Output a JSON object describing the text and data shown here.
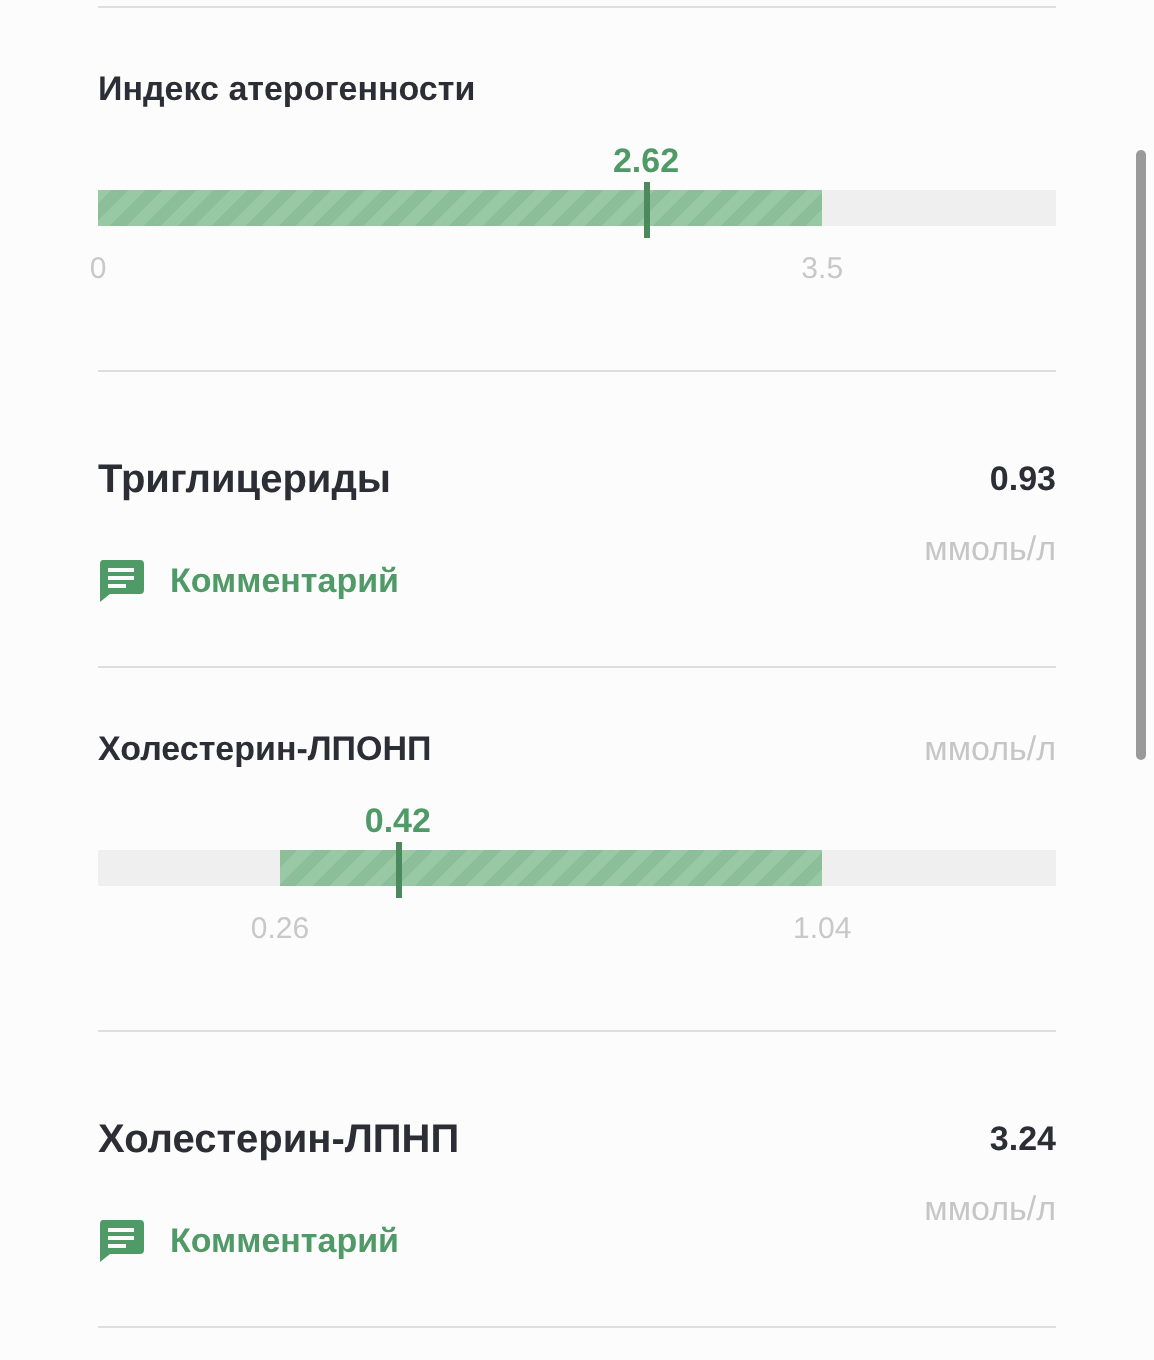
{
  "items": [
    {
      "kind": "range",
      "title": "Индекс атерогенности",
      "value": "2.62",
      "level": 0.572,
      "norm_from": {
        "label": "0"
      },
      "norm_to": {
        "level": 0.756,
        "label": "3.5"
      }
    },
    {
      "kind": "result",
      "title": "Триглицериды",
      "value": "0.93",
      "unit": "ммоль/л",
      "comment": "Комментарий"
    },
    {
      "kind": "range",
      "title": "Холестерин-ЛПОНП",
      "unit": "ммоль/л",
      "value": "0.42",
      "level": 0.313,
      "norm_from": {
        "level": 0.19,
        "label": "0.26"
      },
      "norm_to": {
        "level": 0.756,
        "label": "1.04"
      }
    },
    {
      "kind": "result",
      "title": "Холестерин-ЛПНП",
      "value": "3.24",
      "unit": "ммоль/л",
      "comment": "Комментарий"
    }
  ]
}
